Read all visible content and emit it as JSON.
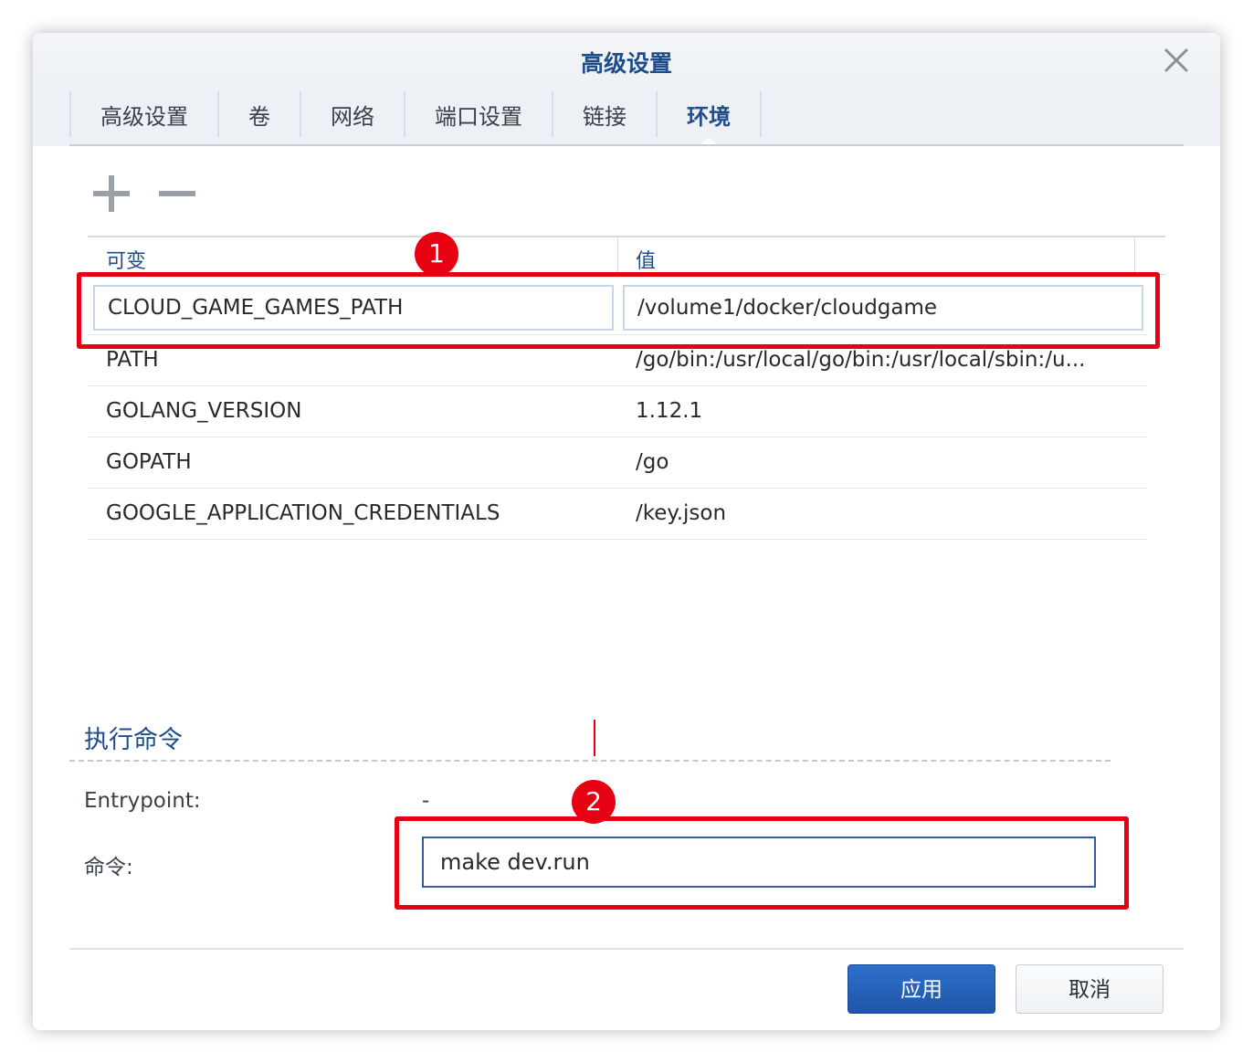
{
  "dialog": {
    "title": "高级设置",
    "close_icon": "close-icon"
  },
  "tabs": [
    {
      "label": "高级设置",
      "active": false
    },
    {
      "label": "卷",
      "active": false
    },
    {
      "label": "网络",
      "active": false
    },
    {
      "label": "端口设置",
      "active": false
    },
    {
      "label": "链接",
      "active": false
    },
    {
      "label": "环境",
      "active": true
    }
  ],
  "toolbar": {
    "add_icon": "plus-icon",
    "remove_icon": "minus-icon"
  },
  "env_table": {
    "columns": [
      "可变",
      "值"
    ],
    "rows": [
      {
        "name": "CLOUD_GAME_GAMES_PATH",
        "value": "/volume1/docker/cloudgame",
        "editing": true
      },
      {
        "name": "PATH",
        "value": "/go/bin:/usr/local/go/bin:/usr/local/sbin:/u...",
        "editing": false
      },
      {
        "name": "GOLANG_VERSION",
        "value": "1.12.1",
        "editing": false
      },
      {
        "name": "GOPATH",
        "value": "/go",
        "editing": false
      },
      {
        "name": "GOOGLE_APPLICATION_CREDENTIALS",
        "value": "/key.json",
        "editing": false
      }
    ]
  },
  "annotations": {
    "badge1": "1",
    "badge2": "2",
    "color": "#e60012"
  },
  "exec": {
    "section_title": "执行命令",
    "entrypoint_label": "Entrypoint:",
    "entrypoint_value": "-",
    "command_label": "命令:",
    "command_value": "make dev.run"
  },
  "footer": {
    "apply_label": "应用",
    "cancel_label": "取消"
  },
  "colors": {
    "accent": "#1f4c8a",
    "primary_button": "#2563bd"
  }
}
